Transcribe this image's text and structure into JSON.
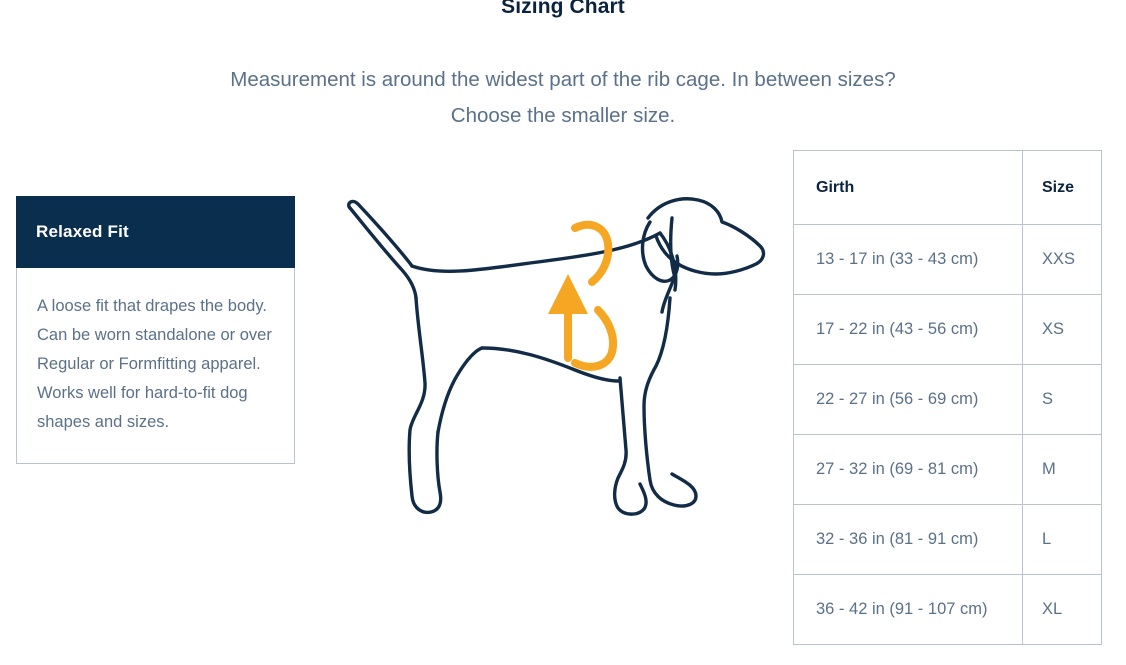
{
  "header": {
    "title": "Sizing Chart",
    "subtitle_lines": [
      "Measurement is around the widest part of the rib cage. In between sizes?",
      "Choose the smaller size."
    ]
  },
  "fit_card": {
    "title": "Relaxed Fit",
    "description": "A loose fit that drapes the body. Can be worn standalone or over Regular or Formfitting apparel. Works well for hard-to-fit dog shapes and sizes."
  },
  "illustration": {
    "name": "dog-side-profile-with-girth-measurement",
    "outline_color": "#122B47",
    "measure_color": "#F5A623",
    "measure_label": "girth-measure-loop-arrow"
  },
  "size_table": {
    "columns": [
      "Girth",
      "Size"
    ],
    "rows": [
      {
        "girth": "13 - 17 in (33 - 43 cm)",
        "size": "XXS"
      },
      {
        "girth": "17 - 22 in (43 - 56 cm)",
        "size": "XS"
      },
      {
        "girth": "22 - 27 in (56 - 69 cm)",
        "size": "S"
      },
      {
        "girth": "27 - 32 in (69 - 81 cm)",
        "size": "M"
      },
      {
        "girth": "32 - 36 in (81 - 91 cm)",
        "size": "L"
      },
      {
        "girth": "36 - 42 in (91 - 107 cm)",
        "size": "XL"
      }
    ]
  },
  "colors": {
    "navy": "#0C2340",
    "header_band": "#0A2E4E",
    "body_text": "#5A7189",
    "border": "#B9C4CE",
    "accent_orange": "#F5A623"
  }
}
